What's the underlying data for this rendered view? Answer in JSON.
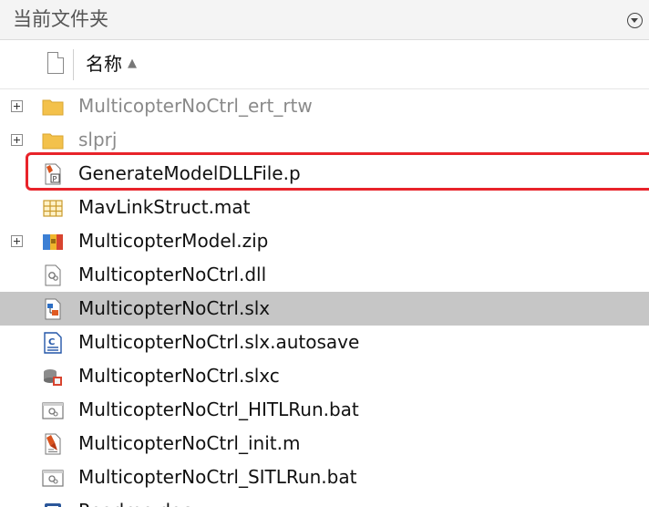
{
  "panel": {
    "title": "当前文件夹"
  },
  "columns": {
    "name": "名称",
    "sort_arrow": "▲"
  },
  "files": [
    {
      "name": "MulticopterNoCtrl_ert_rtw",
      "icon": "folder-icon",
      "expandable": true,
      "kind": "folder"
    },
    {
      "name": "slprj",
      "icon": "folder-icon",
      "expandable": true,
      "kind": "folder"
    },
    {
      "name": "GenerateModelDLLFile.p",
      "icon": "matlab-pcode-icon",
      "expandable": false,
      "kind": "file"
    },
    {
      "name": "MavLinkStruct.mat",
      "icon": "mat-data-icon",
      "expandable": false,
      "kind": "file"
    },
    {
      "name": "MulticopterModel.zip",
      "icon": "zip-archive-icon",
      "expandable": true,
      "kind": "file"
    },
    {
      "name": "MulticopterNoCtrl.dll",
      "icon": "dll-file-icon",
      "expandable": false,
      "kind": "file"
    },
    {
      "name": "MulticopterNoCtrl.slx",
      "icon": "simulink-model-icon",
      "expandable": false,
      "kind": "file",
      "selected": true
    },
    {
      "name": "MulticopterNoCtrl.slx.autosave",
      "icon": "autosave-file-icon",
      "expandable": false,
      "kind": "file"
    },
    {
      "name": "MulticopterNoCtrl.slxc",
      "icon": "slxc-cache-icon",
      "expandable": false,
      "kind": "file"
    },
    {
      "name": "MulticopterNoCtrl_HITLRun.bat",
      "icon": "batch-file-icon",
      "expandable": false,
      "kind": "file"
    },
    {
      "name": "MulticopterNoCtrl_init.m",
      "icon": "matlab-script-icon",
      "expandable": false,
      "kind": "file"
    },
    {
      "name": "MulticopterNoCtrl_SITLRun.bat",
      "icon": "batch-file-icon",
      "expandable": false,
      "kind": "file"
    },
    {
      "name": "Readme.docx",
      "icon": "word-document-icon",
      "expandable": false,
      "kind": "file"
    }
  ],
  "colors": {
    "selection": "#c6c6c6",
    "highlight_border": "#e8232a",
    "folder": "#f3c14b"
  }
}
